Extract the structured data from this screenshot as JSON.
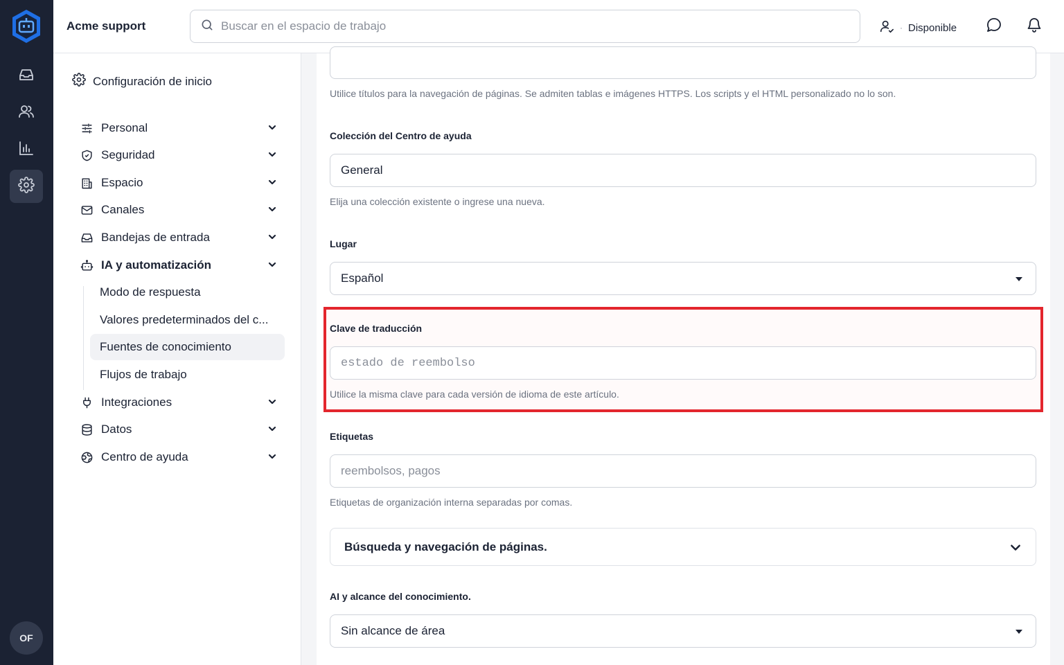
{
  "app": {
    "workspace_name": "Acme support",
    "search_placeholder": "Buscar en el espacio de trabajo",
    "status_label": "Disponible",
    "status_separator": "·",
    "avatar_initials": "OF"
  },
  "rail": {
    "items": [
      {
        "icon": "inbox-icon",
        "active": false
      },
      {
        "icon": "users-icon",
        "active": false
      },
      {
        "icon": "chart-icon",
        "active": false
      },
      {
        "icon": "settings-icon",
        "active": true
      }
    ]
  },
  "sidebar": {
    "header": "Configuración de inicio",
    "sections": [
      {
        "label": "Personal",
        "icon": "sliders-icon"
      },
      {
        "label": "Seguridad",
        "icon": "shield-icon"
      },
      {
        "label": "Espacio",
        "icon": "building-icon"
      },
      {
        "label": "Canales",
        "icon": "mail-icon"
      },
      {
        "label": "Bandejas de entrada",
        "icon": "inbox-icon"
      },
      {
        "label": "IA y automatización",
        "icon": "bot-icon",
        "expanded": true
      },
      {
        "label": "Integraciones",
        "icon": "plug-icon"
      },
      {
        "label": "Datos",
        "icon": "database-icon"
      },
      {
        "label": "Centro de ayuda",
        "icon": "globe-icon"
      }
    ],
    "subitems": [
      {
        "label": "Modo de respuesta"
      },
      {
        "label": "Valores predeterminados del c..."
      },
      {
        "label": "Fuentes de conocimiento",
        "active": true
      },
      {
        "label": "Flujos de trabajo"
      }
    ]
  },
  "form": {
    "body_hint": "Utilice títulos para la navegación de páginas. Se admiten tablas e imágenes HTTPS. Los scripts y el HTML personalizado no lo son.",
    "collection": {
      "label": "Colección del Centro de ayuda",
      "value": "General",
      "hint": "Elija una colección existente o ingrese una nueva."
    },
    "locale": {
      "label": "Lugar",
      "value": "Español"
    },
    "translation_key": {
      "label": "Clave de traducción",
      "placeholder": "estado de reembolso",
      "hint": "Utilice la misma clave para cada versión de idioma de este artículo."
    },
    "tags": {
      "label": "Etiquetas",
      "placeholder": "reembolsos, pagos",
      "hint": "Etiquetas de organización interna separadas por comas."
    },
    "search_nav_section": "Búsqueda y navegación de páginas.",
    "ai_scope": {
      "label": "AI y alcance del conocimiento.",
      "value": "Sin alcance de área"
    }
  },
  "colors": {
    "rail_bg": "#1b2233",
    "accent_logo": "#1f6fe5",
    "highlight_border": "#e3262d"
  }
}
